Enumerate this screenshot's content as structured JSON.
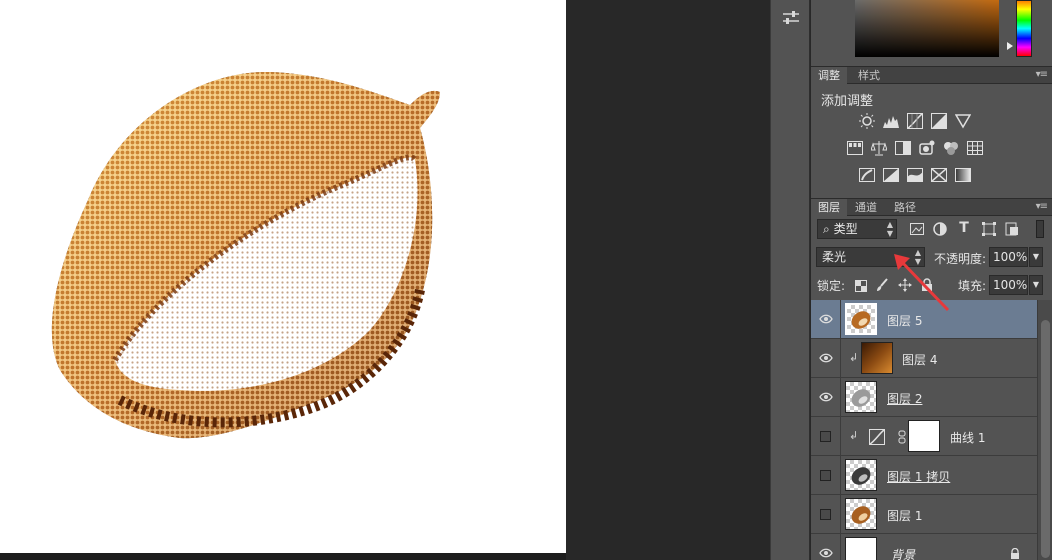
{
  "panels": {
    "adjustments_tabs": [
      "调整",
      "样式"
    ],
    "adjustments_title": "添加调整",
    "layers_tabs": [
      "图层",
      "通道",
      "路径"
    ],
    "filter_kind": "类型",
    "blend_mode": "柔光",
    "opacity_label": "不透明度:",
    "opacity_value": "100%",
    "lock_label": "锁定:",
    "fill_label": "填充:",
    "fill_value": "100%",
    "layer_thumb_t": "T"
  },
  "layers": [
    {
      "name": "图层 5",
      "visible": true,
      "selected": true,
      "thumb": "durian-color"
    },
    {
      "name": "图层 4",
      "visible": true,
      "selected": false,
      "thumb": "gradient-brown",
      "clipped": true
    },
    {
      "name": "图层 2",
      "visible": true,
      "selected": false,
      "thumb": "durian-gray"
    },
    {
      "name": "曲线 1",
      "visible": false,
      "selected": false,
      "thumb": "white-mask",
      "clipped": true,
      "adjustment": true
    },
    {
      "name": "图层 1 拷贝",
      "visible": false,
      "selected": false,
      "thumb": "durian-dark"
    },
    {
      "name": "图层 1",
      "visible": false,
      "selected": false,
      "thumb": "durian-color"
    },
    {
      "name": "背景",
      "visible": true,
      "selected": false,
      "thumb": "white",
      "locked": true
    }
  ],
  "colors": {
    "panel_bg": "#535353",
    "selected_layer": "#6b7c92",
    "annotation_arrow": "#e8393b",
    "durian_dark": "#5a2608",
    "durian_light": "#c9882e"
  }
}
